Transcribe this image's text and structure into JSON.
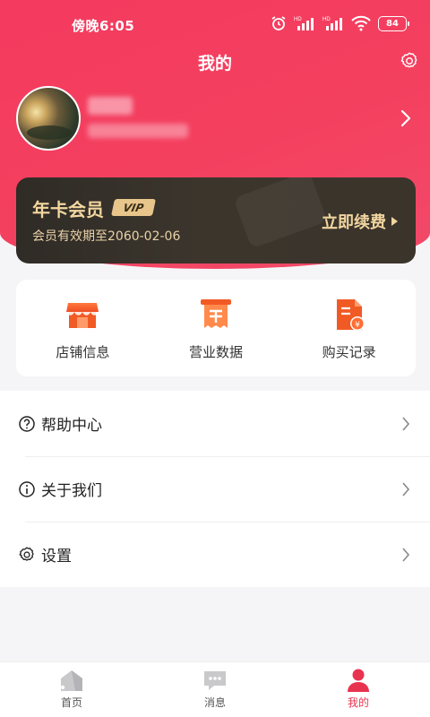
{
  "status_bar": {
    "time": "傍晚6:05",
    "battery": "84"
  },
  "header": {
    "title": "我的"
  },
  "membership": {
    "title": "年卡会员",
    "badge": "VIP",
    "expiry": "会员有效期至2060-02-06",
    "renew_label": "立即续费"
  },
  "quick_actions": [
    {
      "label": "店铺信息",
      "icon": "store-icon"
    },
    {
      "label": "营业数据",
      "icon": "receipt-icon"
    },
    {
      "label": "购买记录",
      "icon": "purchase-record-icon"
    }
  ],
  "menu": [
    {
      "label": "帮助中心",
      "icon": "help-icon"
    },
    {
      "label": "关于我们",
      "icon": "info-icon"
    },
    {
      "label": "设置",
      "icon": "gear-icon"
    }
  ],
  "tabbar": [
    {
      "label": "首页",
      "icon": "home-icon"
    },
    {
      "label": "消息",
      "icon": "message-icon"
    },
    {
      "label": "我的",
      "icon": "user-icon",
      "active": true
    }
  ],
  "colors": {
    "accent": "#f43a5f",
    "card_gold": "#f3d7a0",
    "card_dark": "#2f2b26",
    "orange": "#f05a24"
  }
}
